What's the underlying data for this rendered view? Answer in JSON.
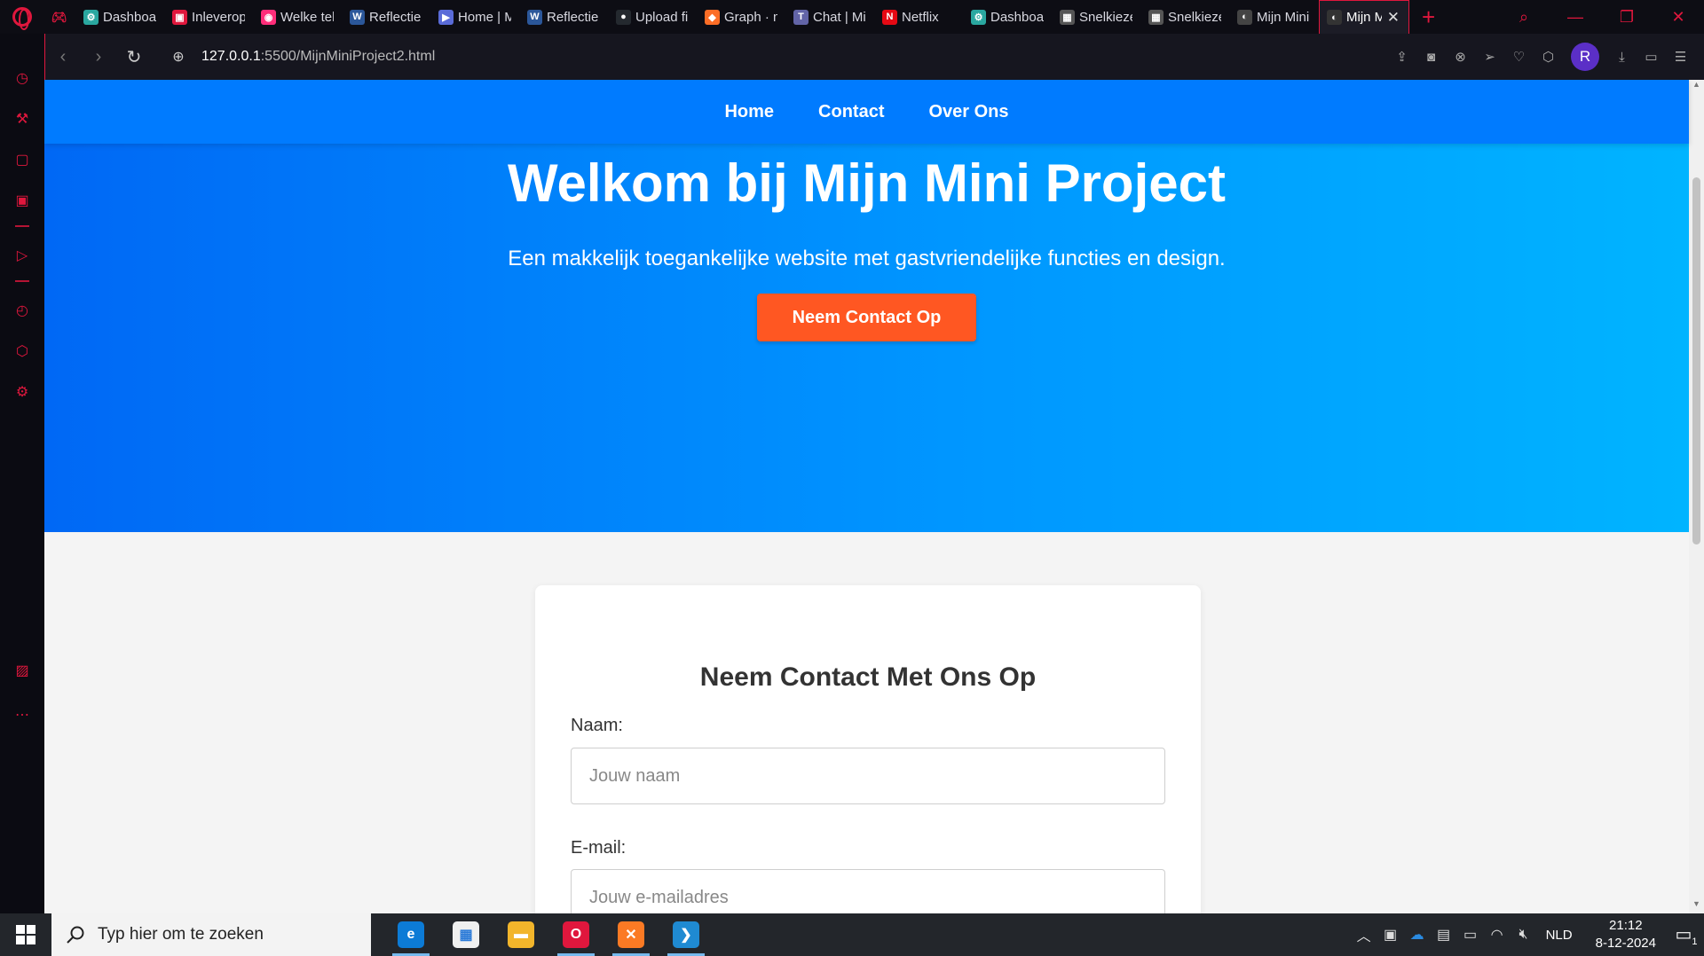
{
  "browser": {
    "tabs": [
      {
        "title": "Dashboard",
        "color": "#2aa7a0",
        "glyph": "⚙"
      },
      {
        "title": "Inleveropdracht",
        "color": "#e0173d",
        "glyph": "▣"
      },
      {
        "title": "Welke tekst",
        "color": "#ff2d7a",
        "glyph": "◉"
      },
      {
        "title": "Reflectie",
        "color": "#2b579a",
        "glyph": "W"
      },
      {
        "title": "Home | M",
        "color": "#5a6bd8",
        "glyph": "▶"
      },
      {
        "title": "Reflectie",
        "color": "#2b579a",
        "glyph": "W"
      },
      {
        "title": "Upload files",
        "color": "#24292f",
        "glyph": "●"
      },
      {
        "title": "Graph · main",
        "color": "#fc6d26",
        "glyph": "◆"
      },
      {
        "title": "Chat | Microsoft Teams",
        "color": "#6264a7",
        "glyph": "T"
      },
      {
        "title": "Netflix",
        "color": "#e50914",
        "glyph": "N"
      },
      {
        "title": "Dashboard",
        "color": "#2aa7a0",
        "glyph": "⚙"
      },
      {
        "title": "Snelkiezer",
        "color": "#555",
        "glyph": "▦"
      },
      {
        "title": "Snelkiezer",
        "color": "#555",
        "glyph": "▦"
      },
      {
        "title": "Mijn Mini Project",
        "color": "#444",
        "glyph": "◐"
      }
    ],
    "active_tab": {
      "title": "Mijn Mini Project",
      "glyph": "◐"
    },
    "url_host": "127.0.0.1",
    "url_rest": ":5500/MijnMiniProject2.html",
    "profile_initial": "R"
  },
  "site": {
    "nav": [
      "Home",
      "Contact",
      "Over Ons"
    ],
    "hero_title": "Welkom bij Mijn Mini Project",
    "hero_subtitle": "Een makkelijk toegankelijke website met gastvriendelijke functies en design.",
    "hero_button": "Neem Contact Op",
    "form_title": "Neem Contact Met Ons Op",
    "name_label": "Naam:",
    "name_placeholder": "Jouw naam",
    "email_label": "E-mail:",
    "email_placeholder": "Jouw e-mailadres"
  },
  "taskbar": {
    "search_placeholder": "Typ hier om te zoeken",
    "apps": [
      {
        "name": "Microsoft Edge",
        "color": "#0c7bd6",
        "glyph": "e"
      },
      {
        "name": "Microsoft Store",
        "color": "#f0f0f0",
        "glyph": "▦"
      },
      {
        "name": "Verkenner",
        "color": "#f2b52b",
        "glyph": "▬"
      },
      {
        "name": "Opera GX",
        "color": "#e0173d",
        "glyph": "O"
      },
      {
        "name": "XAMPP",
        "color": "#fb7a24",
        "glyph": "✕"
      },
      {
        "name": "Visual Studio Code",
        "color": "#1f8ad2",
        "glyph": "❯"
      }
    ],
    "language": "NLD",
    "time": "21:12",
    "date": "8-12-2024",
    "notification_count": "1"
  }
}
